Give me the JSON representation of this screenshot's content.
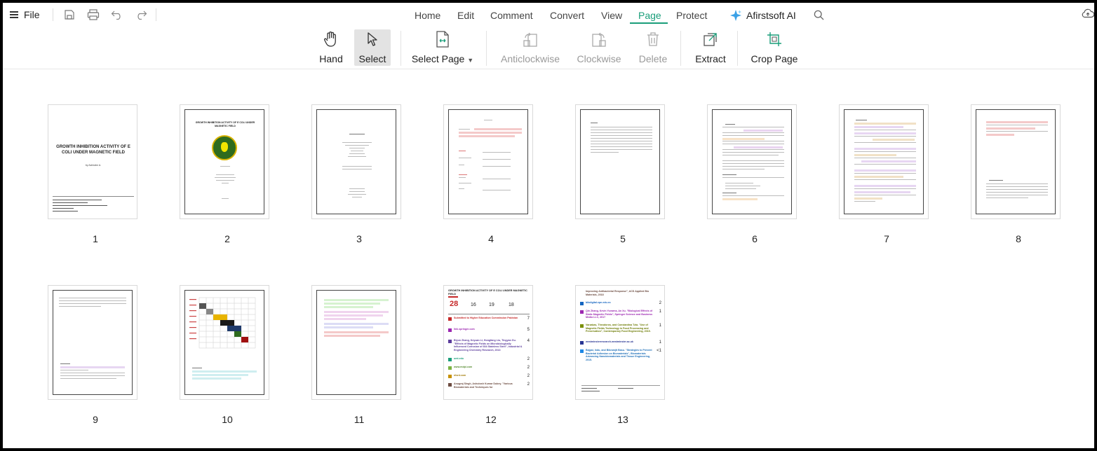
{
  "menu": {
    "file_label": "File",
    "tabs": [
      "Home",
      "Edit",
      "Comment",
      "Convert",
      "View",
      "Page",
      "Protect"
    ],
    "active_tab": "Page",
    "ai_label": "Afirstsoft AI"
  },
  "toolbar": {
    "hand": "Hand",
    "select": "Select",
    "select_page": "Select Page",
    "anticlockwise": "Anticlockwise",
    "clockwise": "Clockwise",
    "delete": "Delete",
    "extract": "Extract",
    "crop_page": "Crop Page"
  },
  "colors": {
    "accent": "#1a9e7a",
    "disabled": "#9a9a9a"
  },
  "pages": {
    "p1": {
      "number": "1",
      "title": "GROWTH INHIBITION ACTIVITY OF E COLI UNDER MAGNETIC FIELD",
      "author": "by Ashiratm A."
    },
    "p2": {
      "number": "2",
      "title": "GROWTH INHIBITION ACTIVITY OF E COLI UNDER MAGNETIC FIELD"
    },
    "p3": {
      "number": "3"
    },
    "p4": {
      "number": "4"
    },
    "p5": {
      "number": "5"
    },
    "p6": {
      "number": "6"
    },
    "p7": {
      "number": "7"
    },
    "p8": {
      "number": "8"
    },
    "p9": {
      "number": "9"
    },
    "p10": {
      "number": "10"
    },
    "p11": {
      "number": "11"
    },
    "p12": {
      "number": "12",
      "title": "GROWTH INHIBITION ACTIVITY OF E COLI UNDER MAGNETIC FIELD",
      "score": "28",
      "stats": [
        "16",
        "19",
        "18"
      ],
      "sources": [
        {
          "text": "Submitted to Higher Education Commission Pakistan",
          "pct": "7"
        },
        {
          "text": "link.springer.com",
          "pct": "5"
        },
        {
          "text": "Biyun Zhang, Keyuan Li, Hongfang Liu, Tingyan Gu. \"Effects of Magnetic Fields on Microbiologically Influenced Corrosion of 304 Stainless Steel\", Industrial & Engineering Chemistry Research, 2013",
          "pct": "4"
        },
        {
          "text": "umt.edu",
          "pct": "2"
        },
        {
          "text": "www.mdpi.com",
          "pct": "2"
        },
        {
          "text": "nlsrd.com",
          "pct": "2"
        },
        {
          "text": "Anugraj Singh, Ashutosh Kumar Dubey. \"Various Biomaterials and Techniques for",
          "pct": "2"
        }
      ]
    },
    "p13": {
      "number": "13",
      "sources": [
        {
          "text": "Improving Antibacterial Response\", ACS Applied Bio Materials, 2018",
          "pct": ""
        },
        {
          "text": "bibdigital.epn.edu.ec",
          "pct": "2"
        },
        {
          "text": "Qin Zhang, Kevin Yuvarna, An Xu. \"Biological Effects of Static Magnetic Fields\", Springer Science and Business Media LLC, 2017",
          "pct": "1"
        },
        {
          "text": "Varzakas, Theodoros, and Constantina Tzia. \"Use of Magnetic Fields Technology in Food Processing and Preservation\", Contemporary Food Engineering, 2015.",
          "pct": "1"
        },
        {
          "text": "westminsterresearch.westminster.ac.uk",
          "pct": "1"
        },
        {
          "text": "Bajpai, Indu, and Bikramjit Basu. \"Strategies to Prevent Bacterial Adhesion on Biomaterials\", Biomaterials Advancing Nanobiomaterials and Tissue Engineering, 2015.",
          "pct": "<1"
        }
      ]
    }
  }
}
